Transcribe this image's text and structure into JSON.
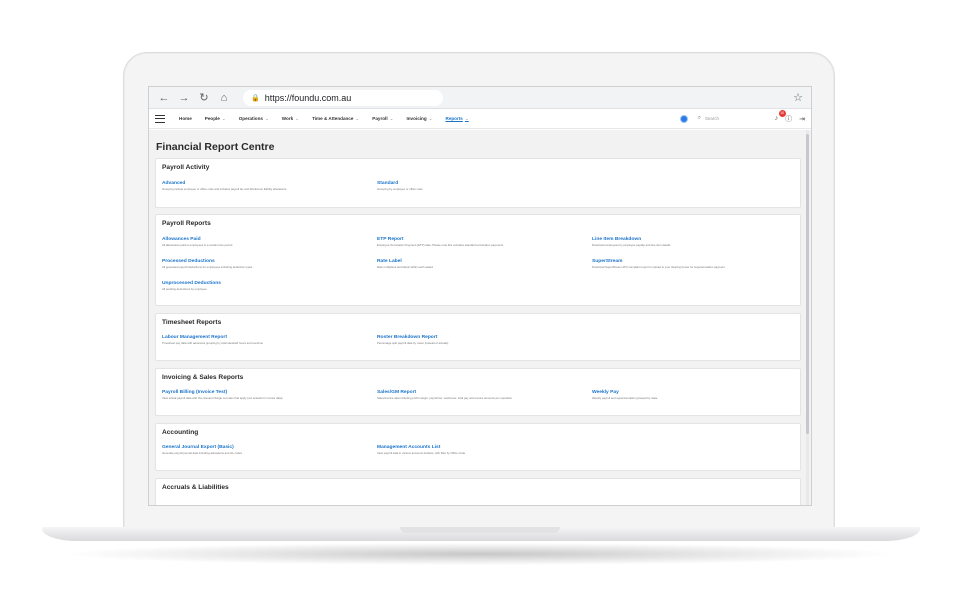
{
  "browser": {
    "url": "https://foundu.com.au",
    "back_icon": "back-arrow-icon",
    "forward_icon": "forward-arrow-icon",
    "reload_icon": "reload-icon",
    "home_icon": "home-icon"
  },
  "nav": {
    "items": [
      {
        "label": "Home",
        "chevron": ""
      },
      {
        "label": "People",
        "chevron": "⌄"
      },
      {
        "label": "Operations",
        "chevron": "⌄"
      },
      {
        "label": "Work",
        "chevron": "⌄"
      },
      {
        "label": "Time & Attendance",
        "chevron": "⌄"
      },
      {
        "label": "Payroll",
        "chevron": "⌄"
      },
      {
        "label": "Invoicing",
        "chevron": "⌄"
      },
      {
        "label": "Reports",
        "chevron": "⌄"
      }
    ],
    "search_placeholder": "Search",
    "notification_count": "10"
  },
  "page": {
    "title": "Financial Report Centre"
  },
  "sections": [
    {
      "title": "Payroll Activity",
      "reports": [
        {
          "name": "Advanced",
          "desc": "Grouping include employee or office code and includes payroll tax and Workcover liability allocations."
        },
        {
          "name": "Standard",
          "desc": "Grouping by employee or office code"
        }
      ]
    },
    {
      "title": "Payroll Reports",
      "reports": [
        {
          "name": "Allowances Paid",
          "desc": "All allowances paid to employees in a certain time period"
        },
        {
          "name": "ETP Report",
          "desc": "Employee Termination Payment (ETP) data. Please note this excludes standard termination payments"
        },
        {
          "name": "Line Item Breakdown",
          "desc": "Download employees by employee payslip and line item details"
        },
        {
          "name": "Processed Deductions",
          "desc": "All generated payroll deductions for employees including deduction types"
        },
        {
          "name": "Rate Label",
          "desc": "Rate multipliers and labels within each award"
        },
        {
          "name": "SuperStream",
          "desc": "Download SuperStream ATO compliant report to upload to your clearing house for superannuation payment"
        },
        {
          "name": "Unprocessed Deductions",
          "desc": "All pending deductions by employee"
        }
      ]
    },
    {
      "title": "Timesheet Reports",
      "reports": [
        {
          "name": "Labour Management Report",
          "desc": "Timesheet pay data with advanced grouping by total standard hours and overtime"
        },
        {
          "name": "Roster Breakdown Report",
          "desc": "Percentage split payroll data by roster (instead of actuals)"
        }
      ]
    },
    {
      "title": "Invoicing & Sales Reports",
      "reports": [
        {
          "name": "Payroll Billing (Invoice Test)",
          "desc": "View actual payroll data with the relevant charge out rates that apply (not actuals for invoice data)"
        },
        {
          "name": "Sales/GM Report",
          "desc": "Sales/invoice data including profit margin, payroll tax, workcover, total pay and invoice amounts per operation"
        },
        {
          "name": "Weekly Pay",
          "desc": "Weekly payroll and superannuation grouped by state"
        }
      ]
    },
    {
      "title": "Accounting",
      "reports": [
        {
          "name": "General Journal Export (Basic)",
          "desc": "Generate payroll journal data including allocations and GL codes"
        },
        {
          "name": "Management Accounts List",
          "desc": "View payroll data in various accounts buckets, with filter by Office Code"
        }
      ]
    },
    {
      "title": "Accruals & Liabilities",
      "reports": []
    }
  ],
  "colors": {
    "link": "#1a73c9",
    "badge": "#e53935",
    "globe": "#2c7be5"
  }
}
